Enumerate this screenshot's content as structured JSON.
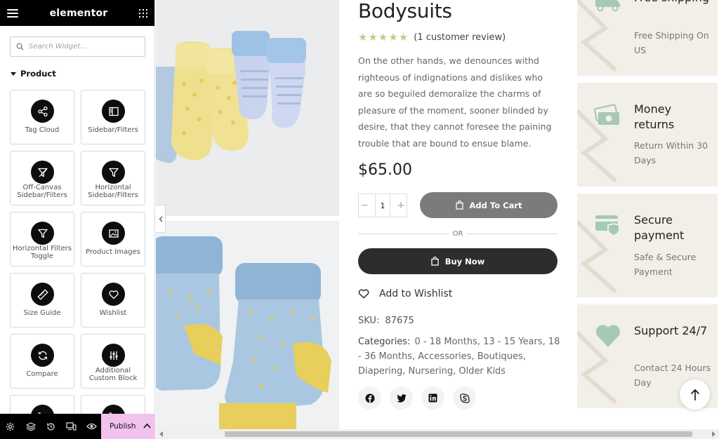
{
  "panel": {
    "logo": "elementor",
    "search_placeholder": "Search Widget...",
    "category": "Product",
    "widgets": [
      {
        "label": "Tag Cloud",
        "icon": "share-nodes-icon"
      },
      {
        "label": "Sidebar/Filters",
        "icon": "sidebar-icon"
      },
      {
        "label": "Off-Canvas Sidebar/Filters",
        "icon": "filter-icon"
      },
      {
        "label": "Horizontal Sidebar/Filters",
        "icon": "filter-icon"
      },
      {
        "label": "Horizontal Filters Toggle",
        "icon": "filter-icon"
      },
      {
        "label": "Product Images",
        "icon": "image-icon"
      },
      {
        "label": "Size Guide",
        "icon": "ruler-icon"
      },
      {
        "label": "Wishlist",
        "icon": "heart-icon"
      },
      {
        "label": "Compare",
        "icon": "refresh-icon"
      },
      {
        "label": "Additional Custom Block",
        "icon": "sliders-icon"
      },
      {
        "label": "",
        "icon": "cart-icon"
      },
      {
        "label": "",
        "icon": "cart-icon"
      }
    ],
    "footer": {
      "publish_label": "Publish"
    }
  },
  "product": {
    "title": "Bodysuits",
    "rating_stars": 5,
    "review_text": "(1 customer review)",
    "description": "On the other hands, we denounces withd righteous of indignations and dislikes who are so beguiled demoralize the charms of pleasure of the moment, sooner blinded by desire, that they cannot foresee the paining trouble that are bound to ensue blame.",
    "price": "$65.00",
    "quantity": "1",
    "add_to_cart": "Add To Cart",
    "or": "OR",
    "buy_now": "Buy Now",
    "wishlist": "Add to Wishlist",
    "sku_label": "SKU:",
    "sku_value": "87675",
    "categories_label": "Categories:",
    "categories_value": "0 - 18 Months, 13 - 15 Years, 18 - 36 Months, Accessories, Boutiques, Diapering, Nursering, Older Kids",
    "socials": [
      "facebook-icon",
      "twitter-icon",
      "linkedin-icon",
      "skype-icon"
    ]
  },
  "features": [
    {
      "title": "Free shipping",
      "subtitle": "Free Shipping On US",
      "icon": "truck-icon"
    },
    {
      "title": "Money returns",
      "subtitle": "Return Within 30 Days",
      "icon": "money-icon"
    },
    {
      "title": "Secure payment",
      "subtitle": "Safe & Secure Payment",
      "icon": "card-shield-icon"
    },
    {
      "title": "Support 24/7",
      "subtitle": "Contact 24 Hours Day",
      "icon": "heart-hand-icon"
    }
  ],
  "colors": {
    "panel_header": "#000000",
    "publish_bg": "#f2c1ee",
    "star": "#b8d08a",
    "feature_bg": "#f2efe9",
    "feature_icon": "#a5c9b2",
    "add_cart_bg": "#7a7b7c",
    "buy_now_bg": "#2c2d2f"
  }
}
